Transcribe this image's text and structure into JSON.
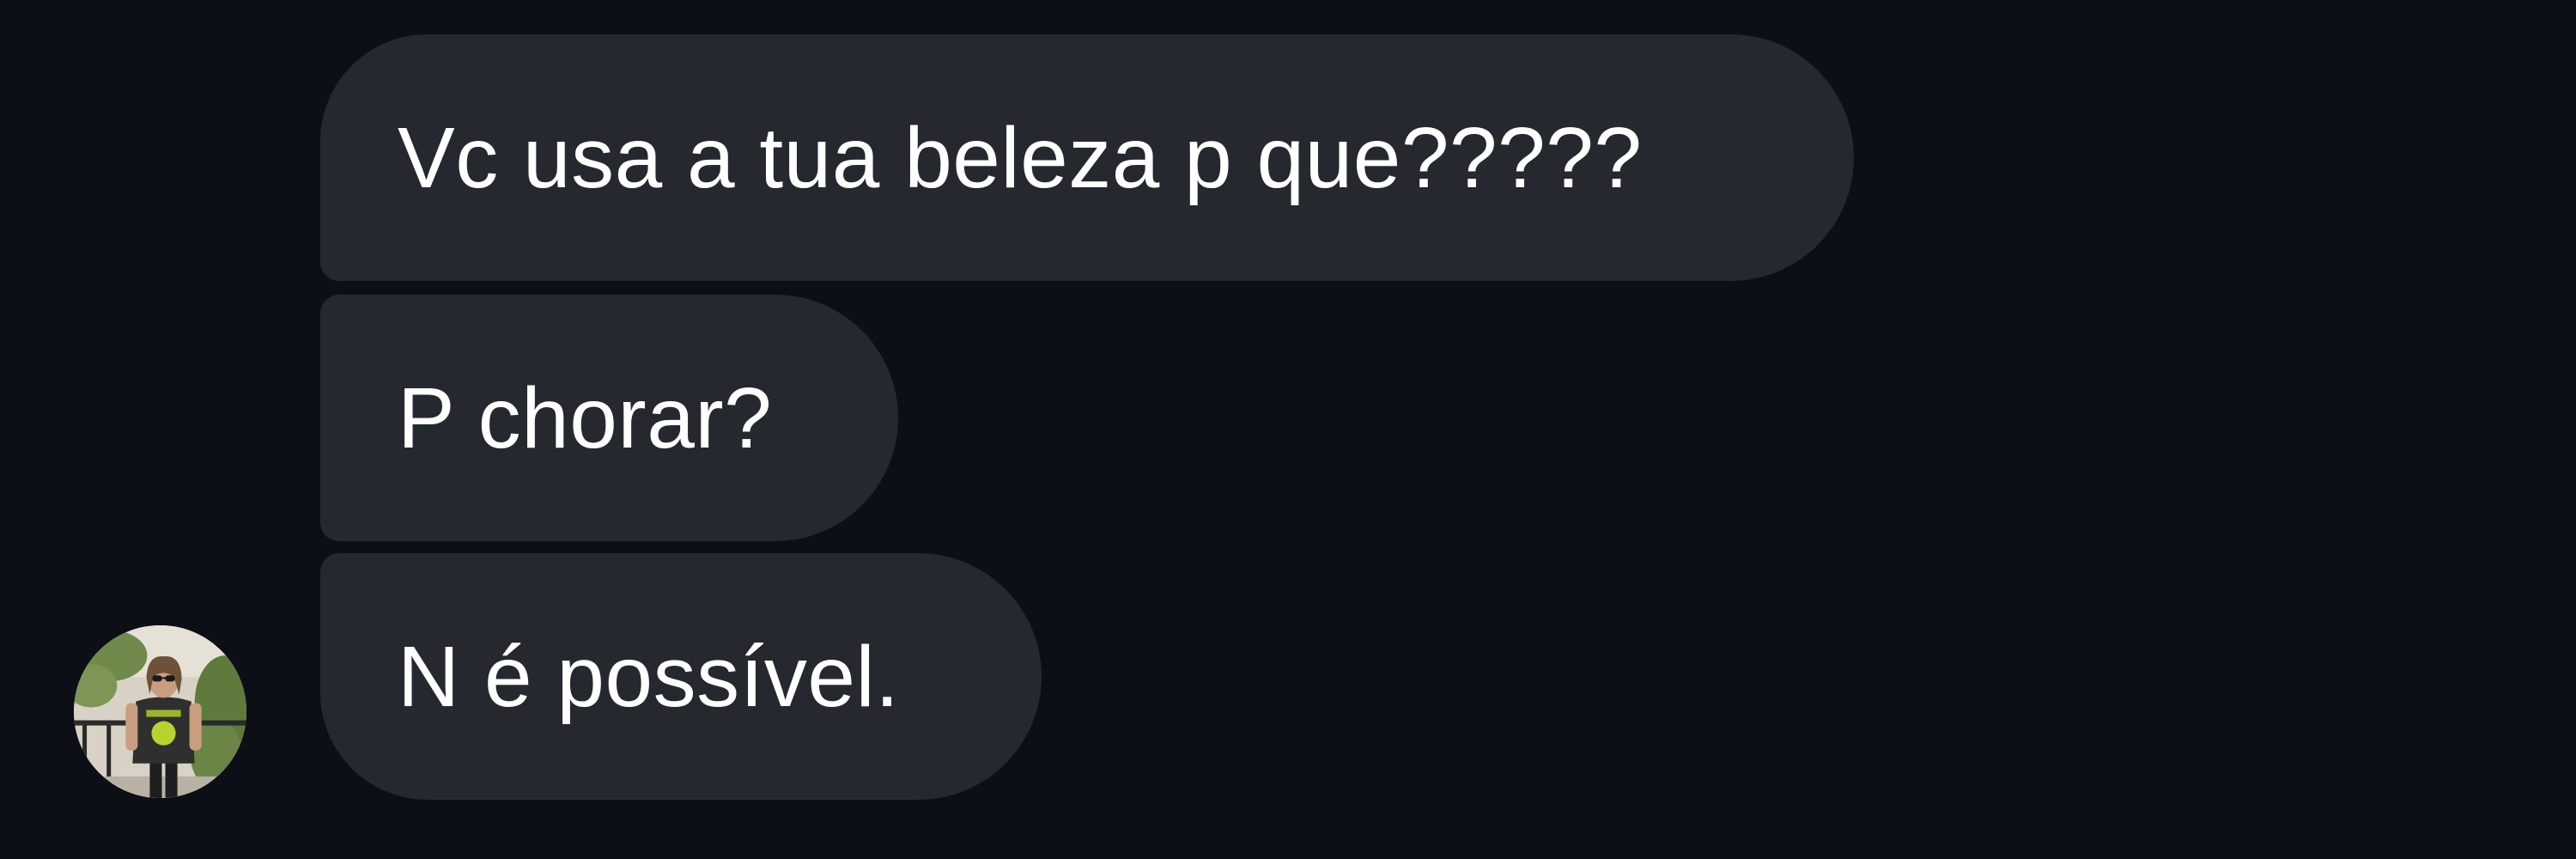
{
  "conversation": {
    "messages": [
      {
        "text": "Vc usa a tua beleza p que?????"
      },
      {
        "text": "P chorar?"
      },
      {
        "text": "N é possível."
      }
    ],
    "sender_avatar": {
      "icon": "user-avatar-photo"
    }
  },
  "colors": {
    "background": "#0c0f15",
    "bubble": "#25282e",
    "text": "#ffffff"
  }
}
